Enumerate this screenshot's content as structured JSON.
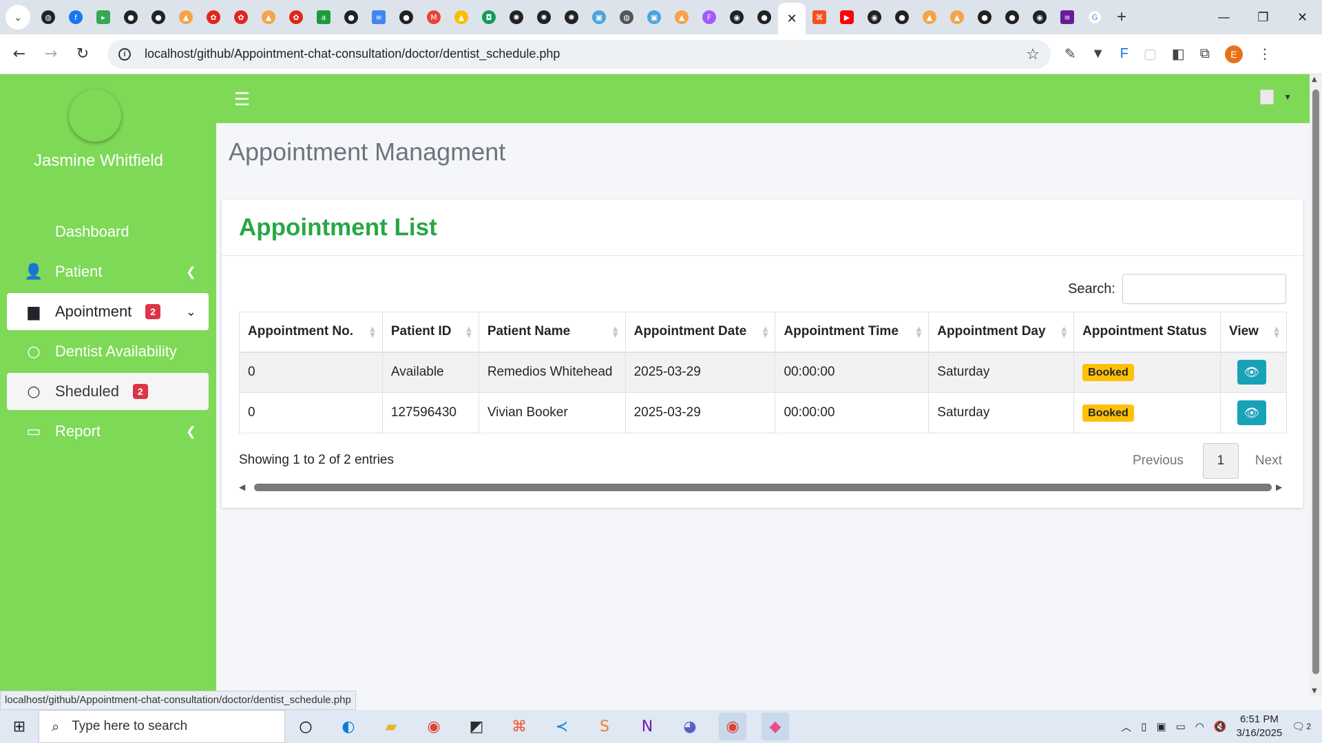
{
  "browser": {
    "url": "localhost/github/Appointment-chat-consultation/doctor/dentist_schedule.php",
    "status_url": "localhost/github/Appointment-chat-consultation/doctor/dentist_schedule.php",
    "profile_initial": "E",
    "tab_count": 32
  },
  "sidebar": {
    "username": "Jasmine Whitfield",
    "items": [
      {
        "label": "Dashboard",
        "icon": "none"
      },
      {
        "label": "Patient",
        "icon": "user-icon"
      },
      {
        "label": "Apointment",
        "icon": "calendar-icon",
        "badge": "2"
      },
      {
        "label": "Dentist Availability",
        "icon": "circle-icon"
      },
      {
        "label": "Sheduled",
        "icon": "circle-icon",
        "badge": "2"
      },
      {
        "label": "Report",
        "icon": "desktop-icon"
      }
    ]
  },
  "page": {
    "title": "Appointment Managment",
    "card_title": "Appointment List",
    "search_label": "Search:",
    "search_value": ""
  },
  "table": {
    "headers": [
      "Appointment No.",
      "Patient ID",
      "Patient Name",
      "Appointment Date",
      "Appointment Time",
      "Appointment Day",
      "Appointment Status",
      "View"
    ],
    "rows": [
      {
        "no": "0",
        "patient_id": "Available",
        "name": "Remedios Whitehead",
        "date": "2025-03-29",
        "time": "00:00:00",
        "day": "Saturday",
        "status": "Booked"
      },
      {
        "no": "0",
        "patient_id": "127596430",
        "name": "Vivian Booker",
        "date": "2025-03-29",
        "time": "00:00:00",
        "day": "Saturday",
        "status": "Booked"
      }
    ],
    "info": "Showing 1 to 2 of 2 entries",
    "pagination": {
      "previous": "Previous",
      "current": "1",
      "next": "Next"
    }
  },
  "taskbar": {
    "search_placeholder": "Type here to search",
    "time": "6:51 PM",
    "date": "3/16/2025",
    "notification_count": "2"
  },
  "colors": {
    "sidebar_green": "#7ed957",
    "title_green": "#28a745",
    "badge_red": "#dc3545",
    "badge_yellow": "#ffc107",
    "view_btn": "#17a2b8"
  }
}
